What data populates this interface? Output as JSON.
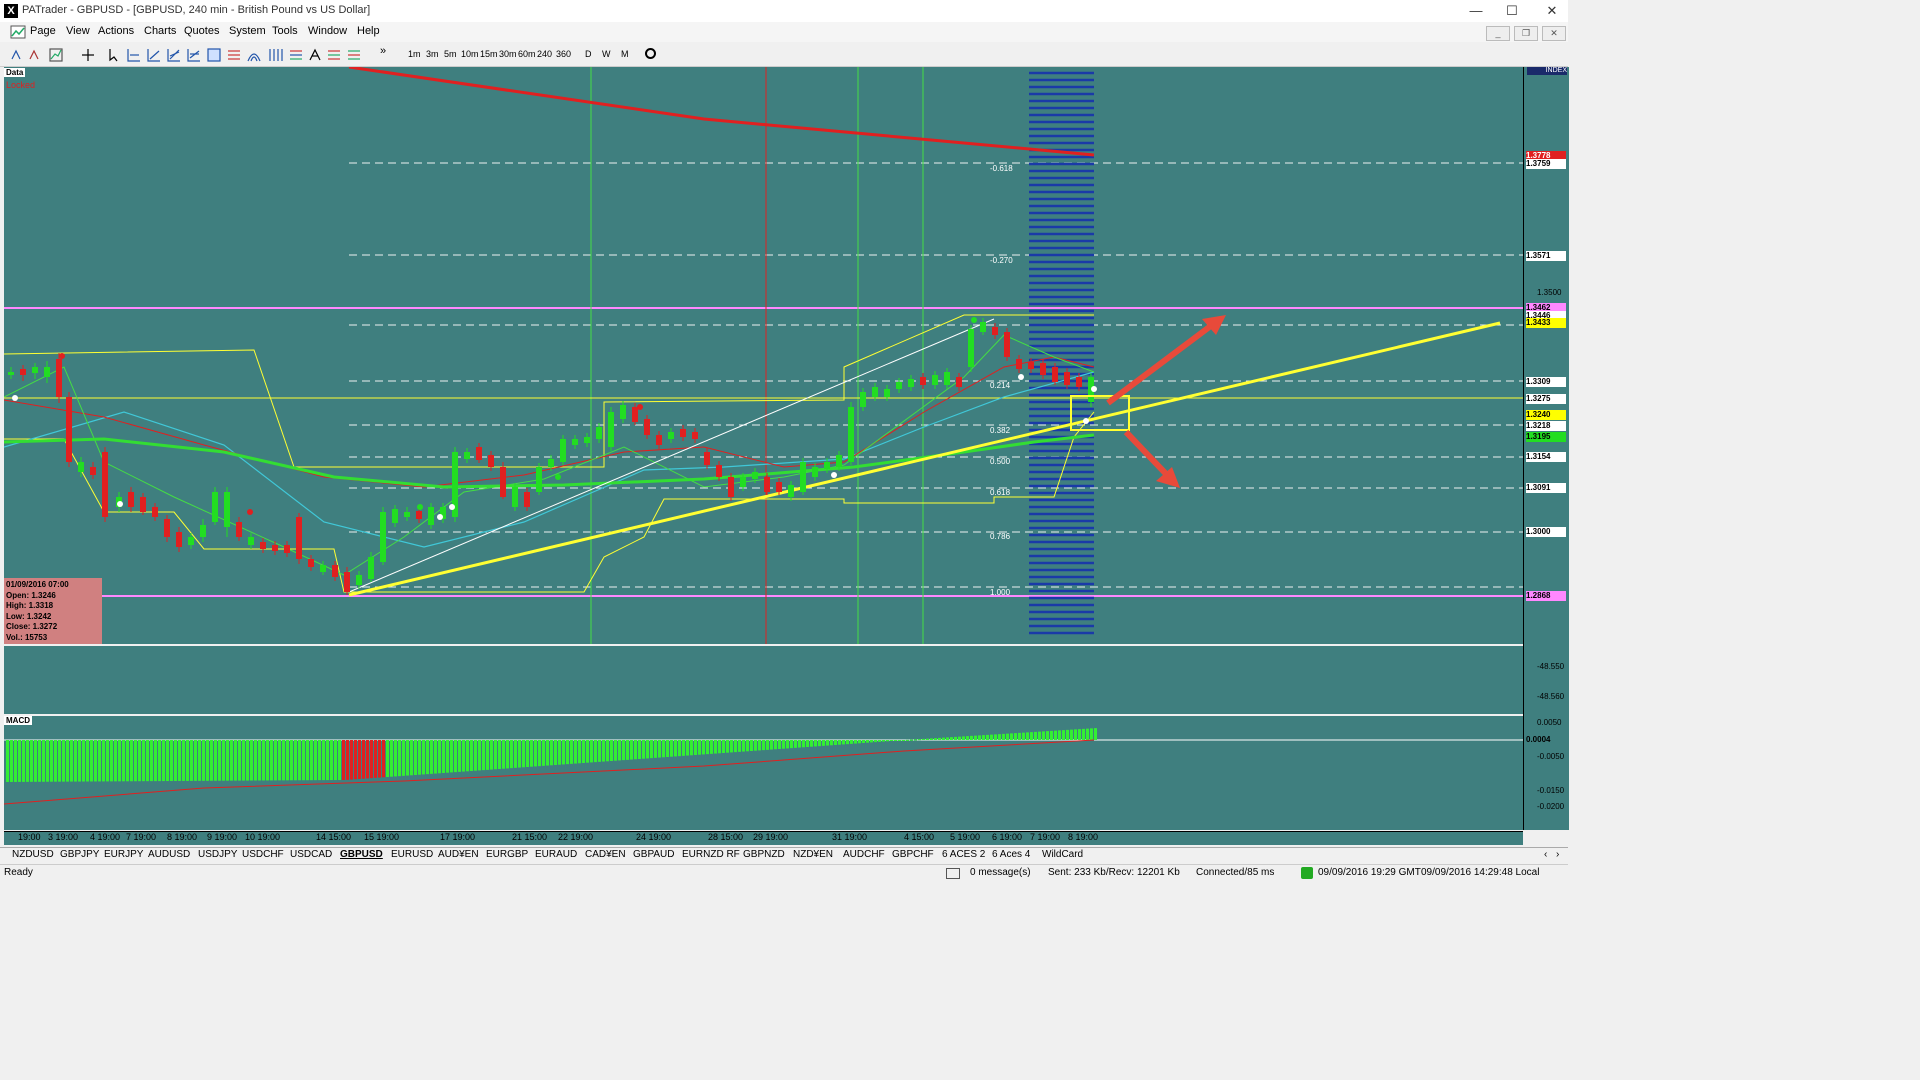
{
  "window": {
    "title": "PATrader - GBPUSD - [GBPUSD, 240 min - British Pound vs US Dollar]",
    "minimize": "—",
    "maximize": "☐",
    "close": "✕"
  },
  "menu": [
    "Page",
    "View",
    "Actions",
    "Charts",
    "Quotes",
    "System",
    "Tools",
    "Window",
    "Help"
  ],
  "timeframes": [
    "1m",
    "3m",
    "5m",
    "10m",
    "15m",
    "30m",
    "60m",
    "240",
    "360",
    "D",
    "W",
    "M"
  ],
  "toolbar_overflow": "»",
  "chart": {
    "symbol": "GBPUSD",
    "data_tag": "Data",
    "locked_label": "Locked",
    "index_tag": "INDEX",
    "macd_tag": "MACD",
    "bar_info": {
      "date": "01/09/2016 07:00",
      "open": "Open: 1.3246",
      "high": "High: 1.3318",
      "low": "Low: 1.3242",
      "close": "Close: 1.3272",
      "vol": "Vol.: 15753"
    },
    "fib_levels": [
      "-0.618",
      "-0.270",
      "0.214",
      "0.382",
      "0.500",
      "0.618",
      "0.786",
      "1.000"
    ],
    "price_labels": [
      {
        "text": "1.3778",
        "color": "#e02020"
      },
      {
        "text": "1.3759",
        "color": "#ffffff"
      },
      {
        "text": "1.3571",
        "color": "#ffffff"
      },
      {
        "text": "1.3462",
        "color": "#ff88ff"
      },
      {
        "text": "1.3446",
        "color": "#ffffff"
      },
      {
        "text": "1.3433",
        "color": "#ffff00"
      },
      {
        "text": "1.3309",
        "color": "#ffffff"
      },
      {
        "text": "1.3275",
        "color": "#ffffff"
      },
      {
        "text": "1.3240",
        "color": "#ffff00"
      },
      {
        "text": "1.3218",
        "color": "#ffffff"
      },
      {
        "text": "1.3195",
        "color": "#22dd22"
      },
      {
        "text": "1.3154",
        "color": "#ffffff"
      },
      {
        "text": "1.3091",
        "color": "#ffffff"
      },
      {
        "text": "1.3000",
        "color": "#ffffff"
      },
      {
        "text": "1.2868",
        "color": "#ff88ff"
      }
    ],
    "axis_ticks": [
      "1.3500"
    ],
    "mid_ticks": [
      "-48.550",
      "-48.560"
    ],
    "macd_ticks": [
      "0.0050",
      "0.0004",
      "-0.0050",
      "-0.0150",
      "-0.0200"
    ],
    "time_labels": [
      "19:00",
      "3 19:00",
      "4 19:00",
      "7 19:00",
      "8 19:00",
      "9 19:00",
      "10 19:00",
      "14 15:00",
      "15 19:00",
      "17 19:00",
      "21 15:00",
      "22 19:00",
      "24 19:00",
      "28 15:00",
      "29 19:00",
      "31 19:00",
      "4 15:00",
      "5 19:00",
      "6 19:00",
      "7 19:00",
      "8 19:00"
    ]
  },
  "tabs": [
    "NZDUSD",
    "GBPJPY",
    "EURJPY",
    "AUDUSD",
    "USDJPY",
    "USDCHF",
    "USDCAD",
    "GBPUSD",
    "EURUSD",
    "AUD¥EN",
    "EURGBP",
    "EURAUD",
    "CAD¥EN",
    "GBPAUD",
    "EURNZD RF",
    "GBPNZD",
    "NZD¥EN",
    "AUDCHF",
    "GBPCHF",
    "6 ACES 2",
    "6 Aces 4",
    "WildCard"
  ],
  "active_tab": "GBPUSD",
  "status": {
    "ready": "Ready",
    "messages": "0 message(s)",
    "traffic": "Sent: 233 Kb/Recv: 12201 Kb",
    "connection": "Connected/85 ms",
    "time_gmt": "09/09/2016 19:29 GMT",
    "time_local": "09/09/2016 14:29:48 Local"
  },
  "colors": {
    "chart_bg": "#3f7f7f",
    "bull": "#22dd22",
    "bear": "#e02020",
    "trend": "#ffff33",
    "ma_red": "#e02020",
    "ma_cyan": "#40c8d8",
    "support": "#ff88ff"
  }
}
